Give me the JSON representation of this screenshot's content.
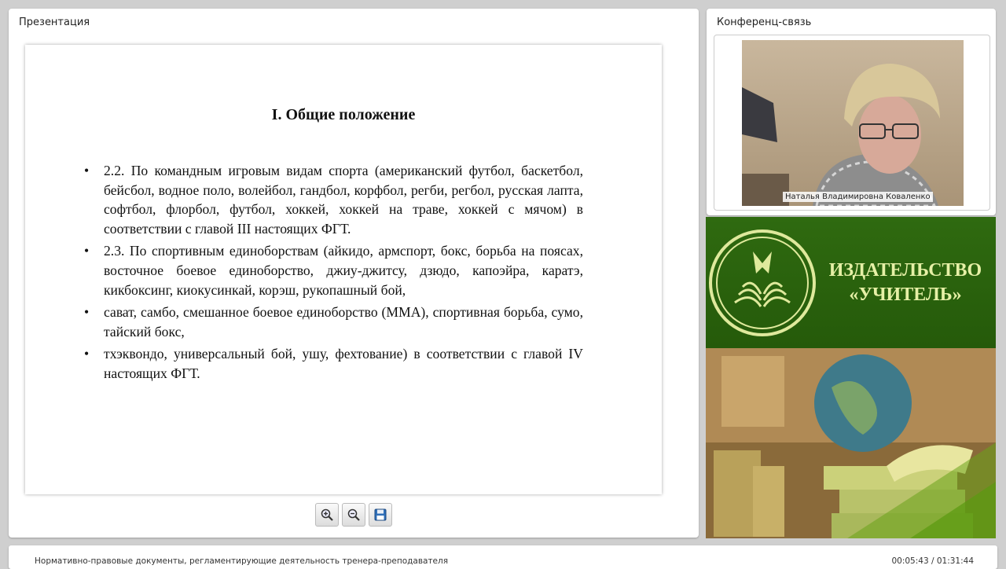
{
  "presentation": {
    "title": "Презентация",
    "slide": {
      "heading": "I. Общие положение",
      "bullets": [
        "2.2. По командным игровым видам спорта (американский футбол, баскетбол, бейсбол, водное поло, волейбол, гандбол, корфбол, регби, регбол, русская лапта, софтбол, флорбол, футбол, хоккей, хоккей на траве, хоккей с мячом) в соответствии с главой III настоящих ФГТ.",
        "2.3. По спортивным единоборствам (айкидо, армспорт, бокс, борьба на поясах, восточное боевое единоборство, джиу-джитсу, дзюдо, капоэйра, каратэ, кикбоксинг, киокусинкай, корэш, рукопашный бой,",
        "сават, самбо, смешанное боевое единоборство (ММА), спортивная борьба, сумо, тайский бокс,",
        "тхэквондо, универсальный бой, ушу, фехтование) в соответствии с главой IV настоящих ФГТ."
      ]
    },
    "toolbar": {
      "zoom_in_icon": "zoom-in-icon",
      "zoom_out_icon": "zoom-out-icon",
      "save_icon": "floppy-disk-icon"
    }
  },
  "conference": {
    "title": "Конференц-связь",
    "participant_name": "Наталья Владимировна Коваленко"
  },
  "banner": {
    "line1": "ИЗДАТЕЛЬСТВО",
    "line2": "«УЧИТЕЛЬ»",
    "colors": {
      "green": "#2c5c0c",
      "text": "#e6f0a6"
    }
  },
  "footer": {
    "course_title": "Нормативно-правовые документы, регламентирующие деятельность тренера-преподавателя",
    "time": "00:05:43 / 01:31:44"
  }
}
